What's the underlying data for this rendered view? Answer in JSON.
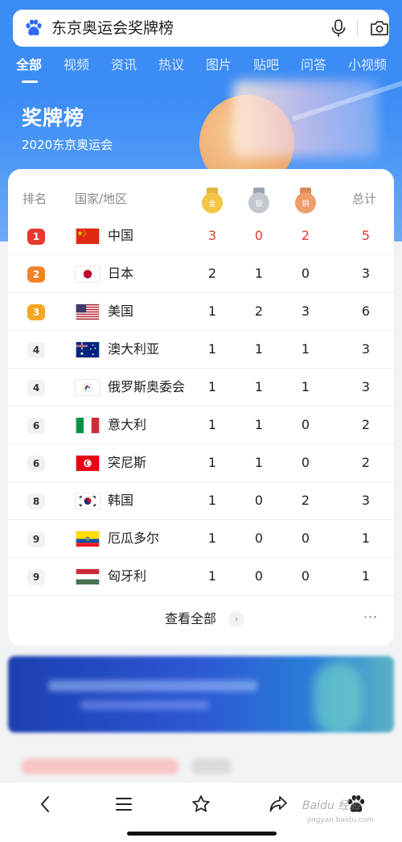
{
  "search": {
    "query": "东京奥运会奖牌榜"
  },
  "tabs": [
    "全部",
    "视频",
    "资讯",
    "热议",
    "图片",
    "贴吧",
    "问答",
    "小视频"
  ],
  "hero": {
    "title": "奖牌榜",
    "subtitle": "2020东京奥运会"
  },
  "table": {
    "headers": {
      "rank": "排名",
      "country": "国家/地区",
      "gold": "金",
      "silver": "银",
      "bronze": "铜",
      "total": "总计"
    },
    "rows": [
      {
        "rank": "1",
        "country": "中国",
        "gold": "3",
        "silver": "0",
        "bronze": "2",
        "total": "5",
        "flag": "china-flag-icon"
      },
      {
        "rank": "2",
        "country": "日本",
        "gold": "2",
        "silver": "1",
        "bronze": "0",
        "total": "3",
        "flag": "japan-flag-icon"
      },
      {
        "rank": "3",
        "country": "美国",
        "gold": "1",
        "silver": "2",
        "bronze": "3",
        "total": "6",
        "flag": "usa-flag-icon"
      },
      {
        "rank": "4",
        "country": "澳大利亚",
        "gold": "1",
        "silver": "1",
        "bronze": "1",
        "total": "3",
        "flag": "australia-flag-icon"
      },
      {
        "rank": "4",
        "country": "俄罗斯奥委会",
        "gold": "1",
        "silver": "1",
        "bronze": "1",
        "total": "3",
        "flag": "roc-flag-icon"
      },
      {
        "rank": "6",
        "country": "意大利",
        "gold": "1",
        "silver": "1",
        "bronze": "0",
        "total": "2",
        "flag": "italy-flag-icon"
      },
      {
        "rank": "6",
        "country": "突尼斯",
        "gold": "1",
        "silver": "1",
        "bronze": "0",
        "total": "2",
        "flag": "tunisia-flag-icon"
      },
      {
        "rank": "8",
        "country": "韩国",
        "gold": "1",
        "silver": "0",
        "bronze": "2",
        "total": "3",
        "flag": "korea-flag-icon"
      },
      {
        "rank": "9",
        "country": "厄瓜多尔",
        "gold": "1",
        "silver": "0",
        "bronze": "0",
        "total": "1",
        "flag": "ecuador-flag-icon"
      },
      {
        "rank": "9",
        "country": "匈牙利",
        "gold": "1",
        "silver": "0",
        "bronze": "0",
        "total": "1",
        "flag": "hungary-flag-icon"
      }
    ],
    "view_all": "查看全部",
    "more": "···"
  },
  "colors": {
    "brand_blue": "#3b8cf5",
    "rank1": "#e53a2f",
    "rank2": "#f08227",
    "rank3": "#f5a623",
    "highlight_red": "#e53a2f"
  },
  "bottom_nav": [
    "back-icon",
    "menu-icon",
    "star-icon",
    "share-icon",
    "paw-icon"
  ],
  "watermark": {
    "brand": "Baidu 经验",
    "url": "jingyan.baidu.com"
  }
}
